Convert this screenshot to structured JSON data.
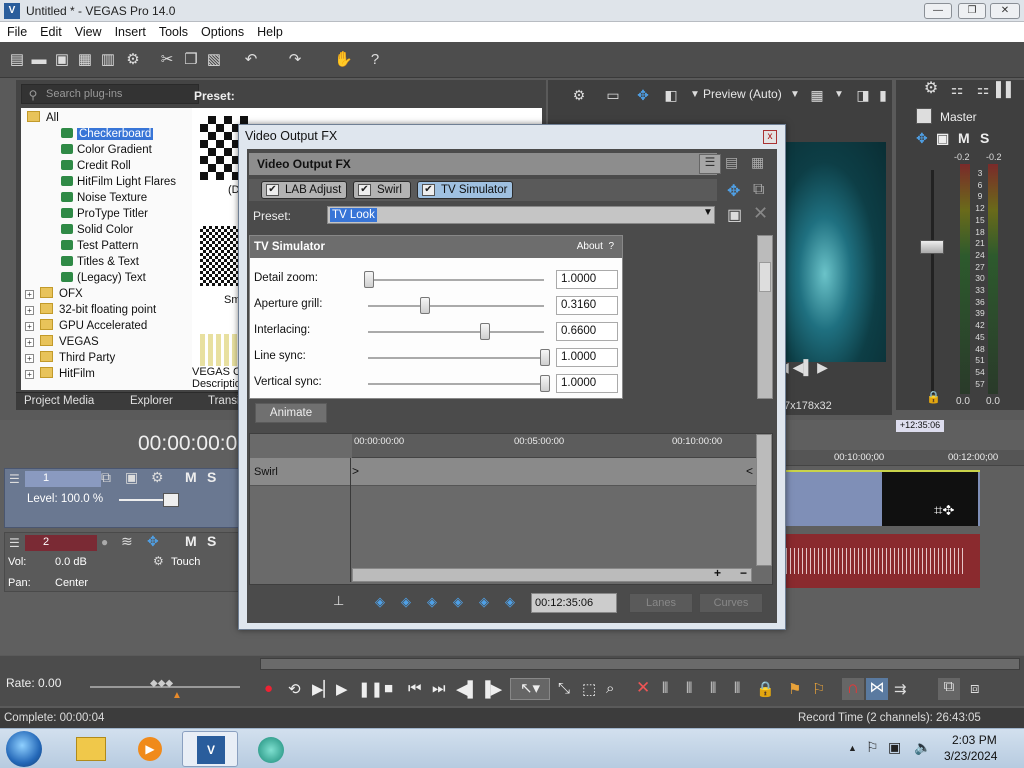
{
  "window": {
    "title": "Untitled * - VEGAS Pro 14.0",
    "logo": "V"
  },
  "menu": [
    "File",
    "Edit",
    "View",
    "Insert",
    "Tools",
    "Options",
    "Help"
  ],
  "plugins": {
    "search_placeholder": "Search plug-ins",
    "preset_label": "Preset:",
    "tree": [
      "All",
      "Checkerboard",
      "Color Gradient",
      "Credit Roll",
      "HitFilm Light Flares",
      "Noise Texture",
      "ProType Titler",
      "Solid Color",
      "Test Pattern",
      "Titles & Text",
      "(Legacy) Text",
      "OFX",
      "32-bit floating point",
      "GPU Accelerated",
      "VEGAS",
      "Third Party",
      "HitFilm"
    ],
    "thumb_labels": [
      "(D",
      "Sm",
      "VEGAS Ch",
      "Descriptio",
      "Transi"
    ],
    "tabs": [
      "Project Media",
      "Explorer"
    ]
  },
  "preview": {
    "quality": "Preview (Auto)",
    "res": "7x178x32"
  },
  "master": {
    "title": "Master",
    "m": "M",
    "s": "S",
    "left_db": "-0.2",
    "right_db": "-0.2",
    "scale": [
      "3",
      "6",
      "9",
      "12",
      "15",
      "18",
      "21",
      "24",
      "27",
      "30",
      "33",
      "36",
      "39",
      "42",
      "45",
      "48",
      "51",
      "54",
      "57"
    ],
    "foot": [
      "0.0",
      "0.0"
    ]
  },
  "timeline": {
    "time": "00:00:00:0",
    "ruler": [
      "00:10:00;00",
      "00:12:00;00"
    ],
    "cursor": "+12:35:06",
    "track1": {
      "num": "1",
      "level": "Level: 100.0 %",
      "m": "M",
      "s": "S"
    },
    "track2": {
      "num": "2",
      "vol_label": "Vol:",
      "vol": "0.0 dB",
      "pan_label": "Pan:",
      "pan": "Center",
      "touch": "Touch",
      "m": "M",
      "s": "S"
    }
  },
  "transport": {
    "rate": "Rate: 0.00"
  },
  "status": {
    "left": "Complete: 00:00:04",
    "right": "Record Time (2 channels): 26:43:05"
  },
  "clock": {
    "time": "2:03 PM",
    "date": "3/23/2024"
  },
  "dialog": {
    "title": "Video Output FX",
    "close": "x",
    "fx_header": "Video Output FX",
    "chain": [
      "LAB Adjust",
      "Swirl",
      "TV Simulator"
    ],
    "preset_label": "Preset:",
    "preset_value": "TV Look",
    "plugin_name": "TV Simulator",
    "about": "About",
    "help": "?",
    "params": [
      {
        "label": "Detail zoom:",
        "value": "1.0000",
        "level": 0.0
      },
      {
        "label": "Aperture grill:",
        "value": "0.3160",
        "level": 0.316
      },
      {
        "label": "Interlacing:",
        "value": "0.6600",
        "level": 0.66
      },
      {
        "label": "Line sync:",
        "value": "1.0000",
        "level": 1.0
      },
      {
        "label": "Vertical sync:",
        "value": "1.0000",
        "level": 1.0
      }
    ],
    "animate": "Animate",
    "kf_ruler": [
      "00:00:00:00",
      "00:05:00:00",
      "00:10:00:00"
    ],
    "kf_track": "Swirl",
    "kf_time": "00:12:35:06",
    "lanes": "Lanes",
    "curves": "Curves"
  }
}
